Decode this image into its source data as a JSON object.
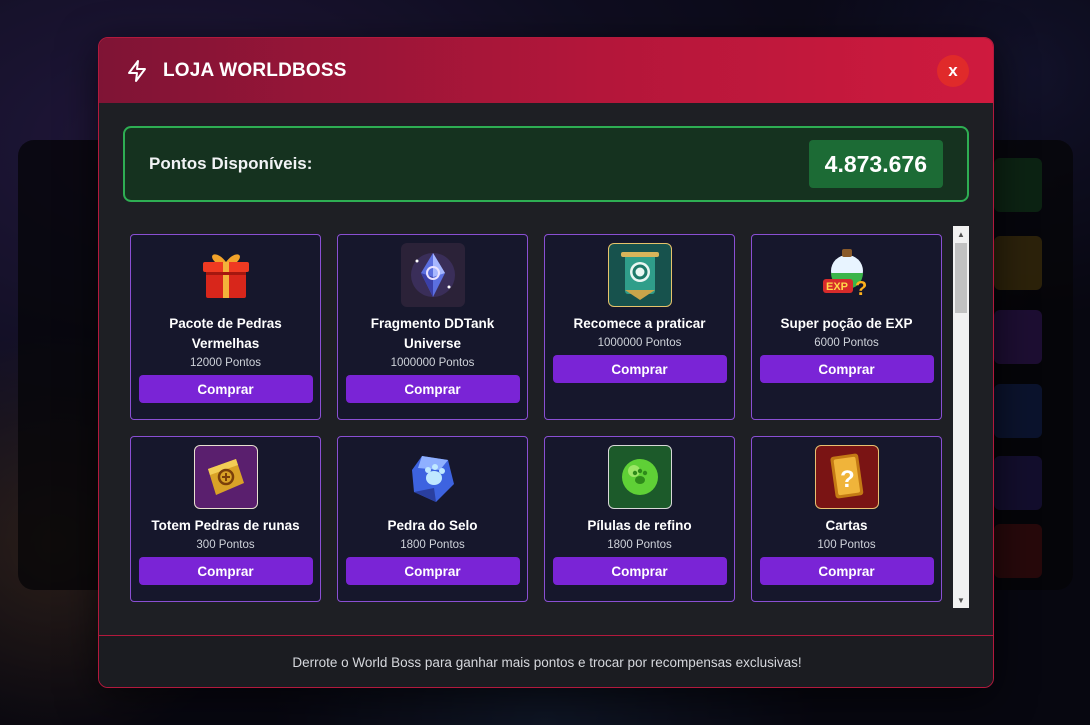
{
  "modal": {
    "title": "LOJA WORLDBOSS",
    "close_label": "x",
    "icon": "lightning-icon"
  },
  "points": {
    "label": "Pontos Disponíveis:",
    "value": "4.873.676"
  },
  "items": [
    {
      "name": "Pacote de Pedras Vermelhas",
      "price": "12000 Pontos",
      "button": "Comprar",
      "icon": "gift-box-icon"
    },
    {
      "name": "Fragmento DDTank Universe",
      "price": "1000000 Pontos",
      "button": "Comprar",
      "icon": "crystal-fragment-icon"
    },
    {
      "name": "Recomece a praticar",
      "price": "1000000 Pontos",
      "button": "Comprar",
      "icon": "scroll-emblem-icon"
    },
    {
      "name": "Super poção de EXP",
      "price": "6000 Pontos",
      "button": "Comprar",
      "icon": "exp-potion-icon"
    },
    {
      "name": "Totem Pedras de runas",
      "price": "300 Pontos",
      "button": "Comprar",
      "icon": "rune-totem-icon"
    },
    {
      "name": "Pedra do Selo",
      "price": "1800 Pontos",
      "button": "Comprar",
      "icon": "seal-stone-icon"
    },
    {
      "name": "Pílulas de refino",
      "price": "1800 Pontos",
      "button": "Comprar",
      "icon": "refine-pill-icon"
    },
    {
      "name": "Cartas",
      "price": "100 Pontos",
      "button": "Comprar",
      "icon": "mystery-card-icon"
    }
  ],
  "footer": {
    "text": "Derrote o World Boss para ganhar mais pontos e trocar por recompensas exclusivas!"
  },
  "colors": {
    "header_start": "#7f1435",
    "header_end": "#cf1a3e",
    "points_border": "#2eae53",
    "points_value_bg": "#1c6b35",
    "buy_button": "#7a24d6",
    "card_border": "#8a4fd3",
    "close_button": "#e02a2a"
  }
}
